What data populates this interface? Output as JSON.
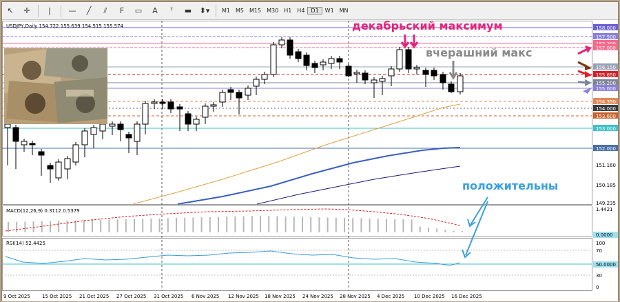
{
  "toolbar": {
    "timeframes": [
      "M1",
      "M5",
      "M15",
      "M30",
      "H1",
      "H4",
      "D1",
      "W1",
      "MN"
    ],
    "active_timeframe": "D1"
  },
  "chart": {
    "header": "USDJPY,Daily  154.722 155.639 154.515 155.574",
    "macd_label": "MACD(12,26,9) 0.3112 0.5379",
    "rsi_label": "RSI(14) 52.4425",
    "price_labels": [
      {
        "text": "158.000",
        "color": "#6b5fd6"
      },
      {
        "text": "157.500",
        "color": "#8a80d8"
      },
      {
        "text": "157.200",
        "color": "#f46b8c"
      },
      {
        "text": "157.000",
        "color": "#f46b8c"
      },
      {
        "text": "156.150",
        "color": "#9aa1b6"
      },
      {
        "text": "155.650",
        "color": "#d6202b"
      },
      {
        "text": "155.200",
        "color": "#7e8597"
      },
      {
        "text": "155.000",
        "color": "#8a80d8"
      },
      {
        "text": "154.350",
        "color": "#e08a5a"
      },
      {
        "text": "154.000",
        "color": "#3a3a3a"
      },
      {
        "text": "153.600",
        "color": "#c8632f"
      },
      {
        "text": "153.000",
        "color": "#3fc1c9"
      },
      {
        "text": "152.000",
        "color": "#4a6fa8"
      },
      {
        "text": "151.160",
        "color": ""
      },
      {
        "text": "150.185",
        "color": ""
      },
      {
        "text": "149.235",
        "color": ""
      }
    ],
    "macd_scale": [
      "1.4421",
      "0.0000"
    ],
    "rsi_scale": [
      "100",
      "70",
      "50.0000",
      "30",
      "0"
    ],
    "dates": [
      "9 Oct 2025",
      "15 Oct 2025",
      "21 Oct 2025",
      "27 Oct 2025",
      "31 Oct 2025",
      "6 Nov 2025",
      "12 Nov 2025",
      "18 Nov 2025",
      "24 Nov 2025",
      "28 Nov 2025",
      "4 Dec 2025",
      "10 Dec 2025",
      "16 Dec 2025"
    ]
  },
  "annotations": {
    "december_max": "декабрьский максимум",
    "yesterday_max": "вчерашний макс",
    "positive": "положительны"
  },
  "colors": {
    "annotation_magenta": "#e8237a",
    "annotation_gray": "#8a8a8a",
    "annotation_blue": "#3aa0dc"
  }
}
